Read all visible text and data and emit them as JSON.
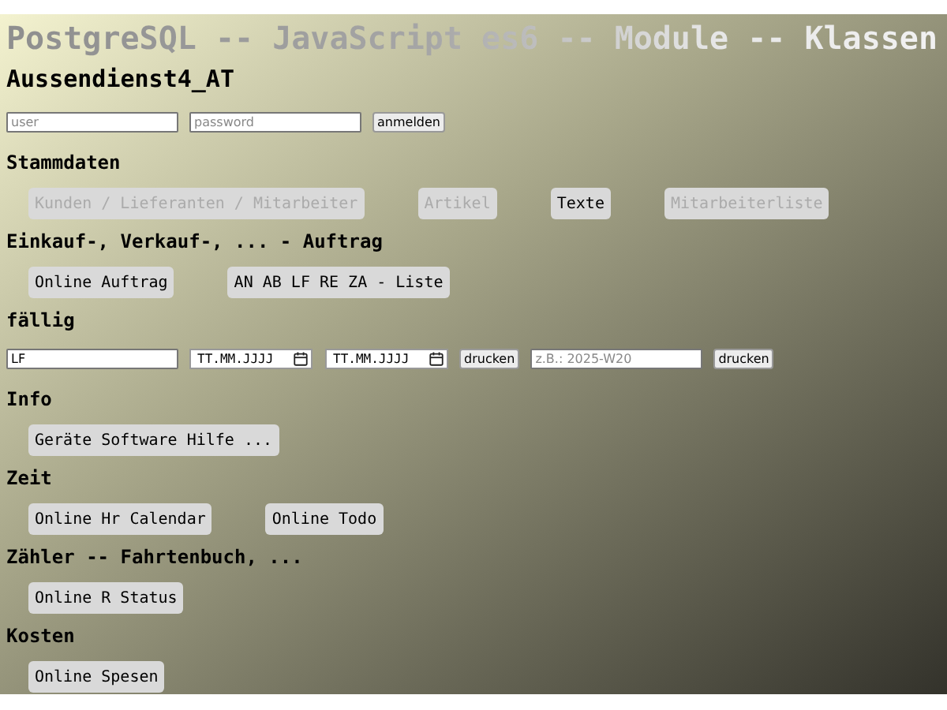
{
  "banner": "PostgreSQL -- JavaScript es6 -- Module -- Klassen",
  "app_title": "Aussendienst4_AT",
  "login": {
    "user_placeholder": "user",
    "password_placeholder": "password",
    "button": "anmelden"
  },
  "sections": [
    {
      "heading": "Stammdaten",
      "kind": "buttons",
      "buttons": [
        {
          "label": "Kunden / Lieferanten / Mitarbeiter",
          "disabled": true
        },
        {
          "label": "Artikel",
          "disabled": true
        },
        {
          "label": "Texte",
          "disabled": false
        },
        {
          "label": "Mitarbeiterliste",
          "disabled": true
        }
      ]
    },
    {
      "heading": "Einkauf-, Verkauf-, ... - Auftrag",
      "kind": "buttons",
      "buttons": [
        {
          "label": "Online Auftrag",
          "disabled": false
        },
        {
          "label": "AN AB LF RE ZA - Liste",
          "disabled": false
        }
      ]
    },
    {
      "heading": "fällig",
      "kind": "fields",
      "fields": [
        {
          "kind": "text",
          "value": "LF"
        },
        {
          "kind": "date",
          "mask": "TT.MM.JJJJ"
        },
        {
          "kind": "date",
          "mask": "TT.MM.JJJJ"
        },
        {
          "kind": "button",
          "label": "drucken"
        },
        {
          "kind": "text",
          "placeholder": "z.B.: 2025-W20"
        },
        {
          "kind": "button",
          "label": "drucken"
        }
      ]
    },
    {
      "heading": "Info",
      "kind": "buttons",
      "buttons": [
        {
          "label": "Geräte Software Hilfe ...",
          "disabled": false
        }
      ]
    },
    {
      "heading": "Zeit",
      "kind": "buttons",
      "buttons": [
        {
          "label": "Online Hr Calendar",
          "disabled": false
        },
        {
          "label": "Online Todo",
          "disabled": false
        }
      ]
    },
    {
      "heading": "Zähler -- Fahrtenbuch, ...",
      "kind": "buttons",
      "buttons": [
        {
          "label": "Online R Status",
          "disabled": false
        }
      ]
    },
    {
      "heading": "Kosten",
      "kind": "buttons",
      "buttons": [
        {
          "label": "Online Spesen",
          "disabled": false
        }
      ]
    }
  ]
}
